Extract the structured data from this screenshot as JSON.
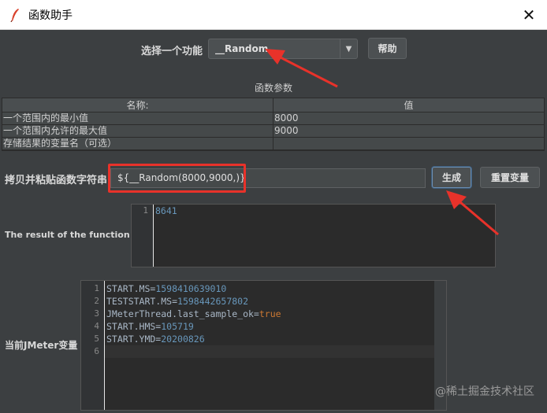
{
  "window": {
    "title": "函数助手",
    "close_glyph": "✕"
  },
  "function_select": {
    "label": "选择一个功能",
    "value": "__Random",
    "help_label": "帮助"
  },
  "params": {
    "title": "函数参数",
    "columns": [
      "名称:",
      "值"
    ],
    "rows": [
      [
        "一个范围内的最小值",
        "8000"
      ],
      [
        "一个范围内允许的最大值",
        "9000"
      ],
      [
        "存储结果的变量名（可选）",
        ""
      ]
    ]
  },
  "copy": {
    "label": "拷贝并粘贴函数字符串",
    "value": "${__Random(8000,9000,)}",
    "generate_label": "生成",
    "reset_label": "重置变量"
  },
  "result": {
    "label": "The result of the function is",
    "lines": [
      {
        "n": "1",
        "text": "8641"
      }
    ]
  },
  "vars": {
    "label": "当前JMeter变量",
    "lines": [
      {
        "n": "1",
        "key": "START.MS=",
        "val": "1598410639010",
        "type": "num"
      },
      {
        "n": "2",
        "key": "TESTSTART.MS=",
        "val": "1598442657802",
        "type": "num"
      },
      {
        "n": "3",
        "key": "JMeterThread.last_sample_ok=",
        "val": "true",
        "type": "kw"
      },
      {
        "n": "4",
        "key": "START.HMS=",
        "val": "105719",
        "type": "num"
      },
      {
        "n": "5",
        "key": "START.YMD=",
        "val": "20200826",
        "type": "num"
      },
      {
        "n": "6",
        "key": "",
        "val": "",
        "type": ""
      }
    ]
  },
  "watermark": "@稀土掘金技术社区",
  "colors": {
    "accent_red": "#e8322a",
    "number": "#6897bb",
    "keyword": "#cc7832",
    "background": "#3c3f41"
  },
  "icons": [
    "feather-icon",
    "close-icon",
    "dropdown-arrow-icon"
  ]
}
